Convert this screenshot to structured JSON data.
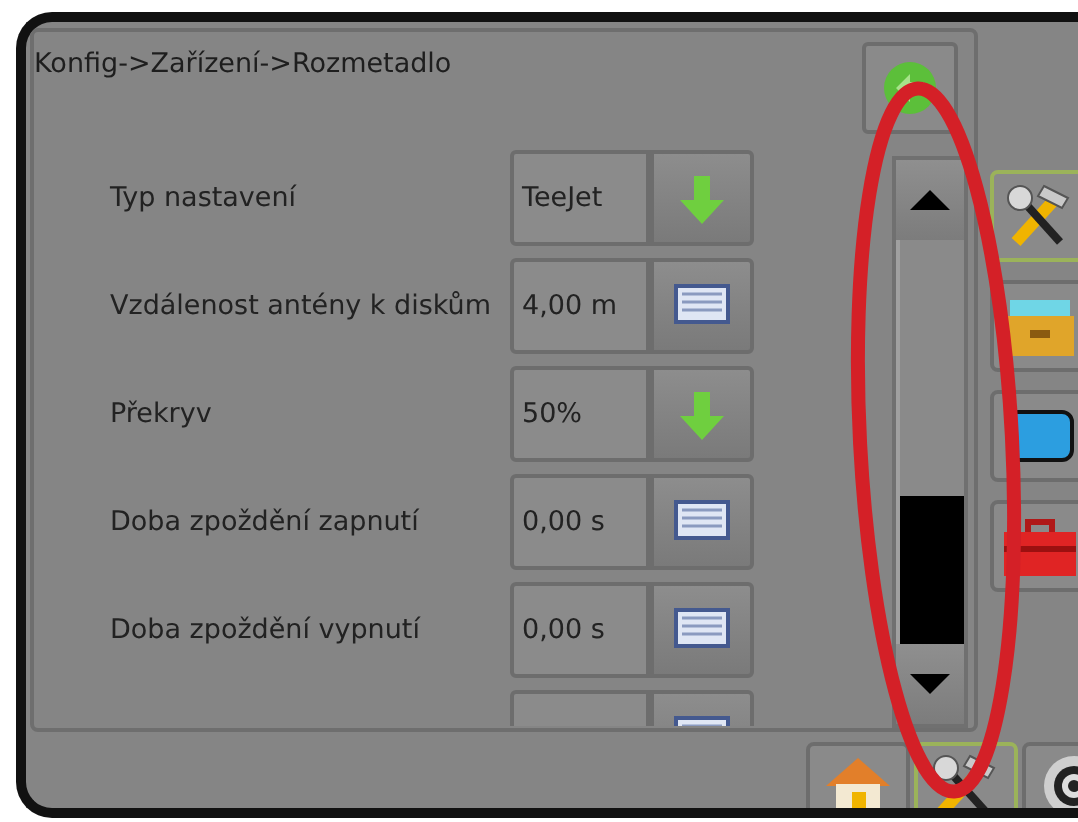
{
  "title": "Konfig->Zařízení->Rozmetadlo",
  "rows": [
    {
      "label": "Typ nastavení",
      "value": "TeeJet",
      "kind": "dropdown"
    },
    {
      "label": "Vzdálenost antény k diskům",
      "value": "4,00 m",
      "kind": "keyboard"
    },
    {
      "label": "Překryv",
      "value": "50%",
      "kind": "dropdown"
    },
    {
      "label": "Doba zpoždění zapnutí",
      "value": "0,00 s",
      "kind": "keyboard"
    },
    {
      "label": "Doba zpoždění vypnutí",
      "value": "0,00 s",
      "kind": "keyboard"
    },
    {
      "kind": "keyboard"
    }
  ],
  "side_tabs": [
    {
      "kind": "tools",
      "selected": true
    },
    {
      "kind": "drawer",
      "selected": false
    },
    {
      "kind": "screen",
      "selected": false
    },
    {
      "kind": "toolbox",
      "selected": false
    }
  ],
  "bottom_tabs": [
    {
      "kind": "home",
      "selected": false
    },
    {
      "kind": "tools",
      "selected": true
    },
    {
      "kind": "disc",
      "selected": false
    }
  ]
}
